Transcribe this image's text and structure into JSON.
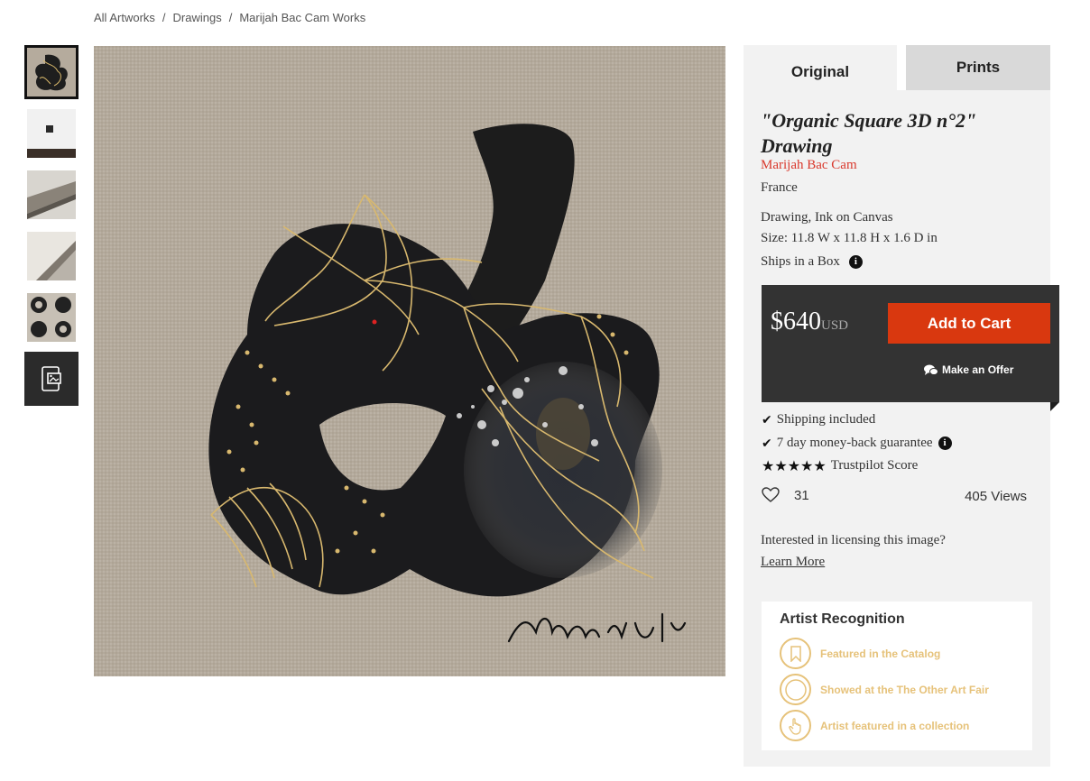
{
  "breadcrumb": {
    "items": [
      "All Artworks",
      "Drawings",
      "Marijah Bac Cam Works"
    ],
    "separator": "/"
  },
  "thumbnails": {
    "count": 5,
    "active_index": 0,
    "view_in_room_icon": "view-in-room-icon"
  },
  "main_image": {
    "signature": "Marijah"
  },
  "tabs": [
    {
      "label": "Original",
      "active": true
    },
    {
      "label": "Prints",
      "active": false
    }
  ],
  "artwork": {
    "title": "\"Organic Square 3D n°2\" Drawing",
    "artist": "Marijah Bac Cam",
    "country": "France",
    "medium": "Drawing, Ink on Canvas",
    "size": "Size: 11.8 W x 11.8 H x 1.6 D in",
    "ships": "Ships in a Box"
  },
  "purchase": {
    "price": "$640",
    "currency": "USD",
    "add_to_cart": "Add to Cart",
    "make_offer": "Make an Offer"
  },
  "benefits": {
    "shipping": "Shipping included",
    "guarantee": "7 day money-back guarantee",
    "trustpilot": "Trustpilot Score",
    "stars": 5
  },
  "stats": {
    "likes": "31",
    "views": "405 Views"
  },
  "licensing": {
    "question": "Interested in licensing this image?",
    "link": "Learn More"
  },
  "recognition": {
    "title": "Artist Recognition",
    "items": [
      {
        "label": "Featured in the Catalog",
        "icon": "bookmark-icon"
      },
      {
        "label": "Showed at the The Other Art Fair",
        "icon": "circle-badge-icon"
      },
      {
        "label": "Artist featured in a collection",
        "icon": "hand-pointer-icon"
      }
    ]
  },
  "colors": {
    "accent_red": "#d9380f",
    "artist_link": "#d9382c",
    "gold": "#e6c27a",
    "price_box": "#333333"
  }
}
